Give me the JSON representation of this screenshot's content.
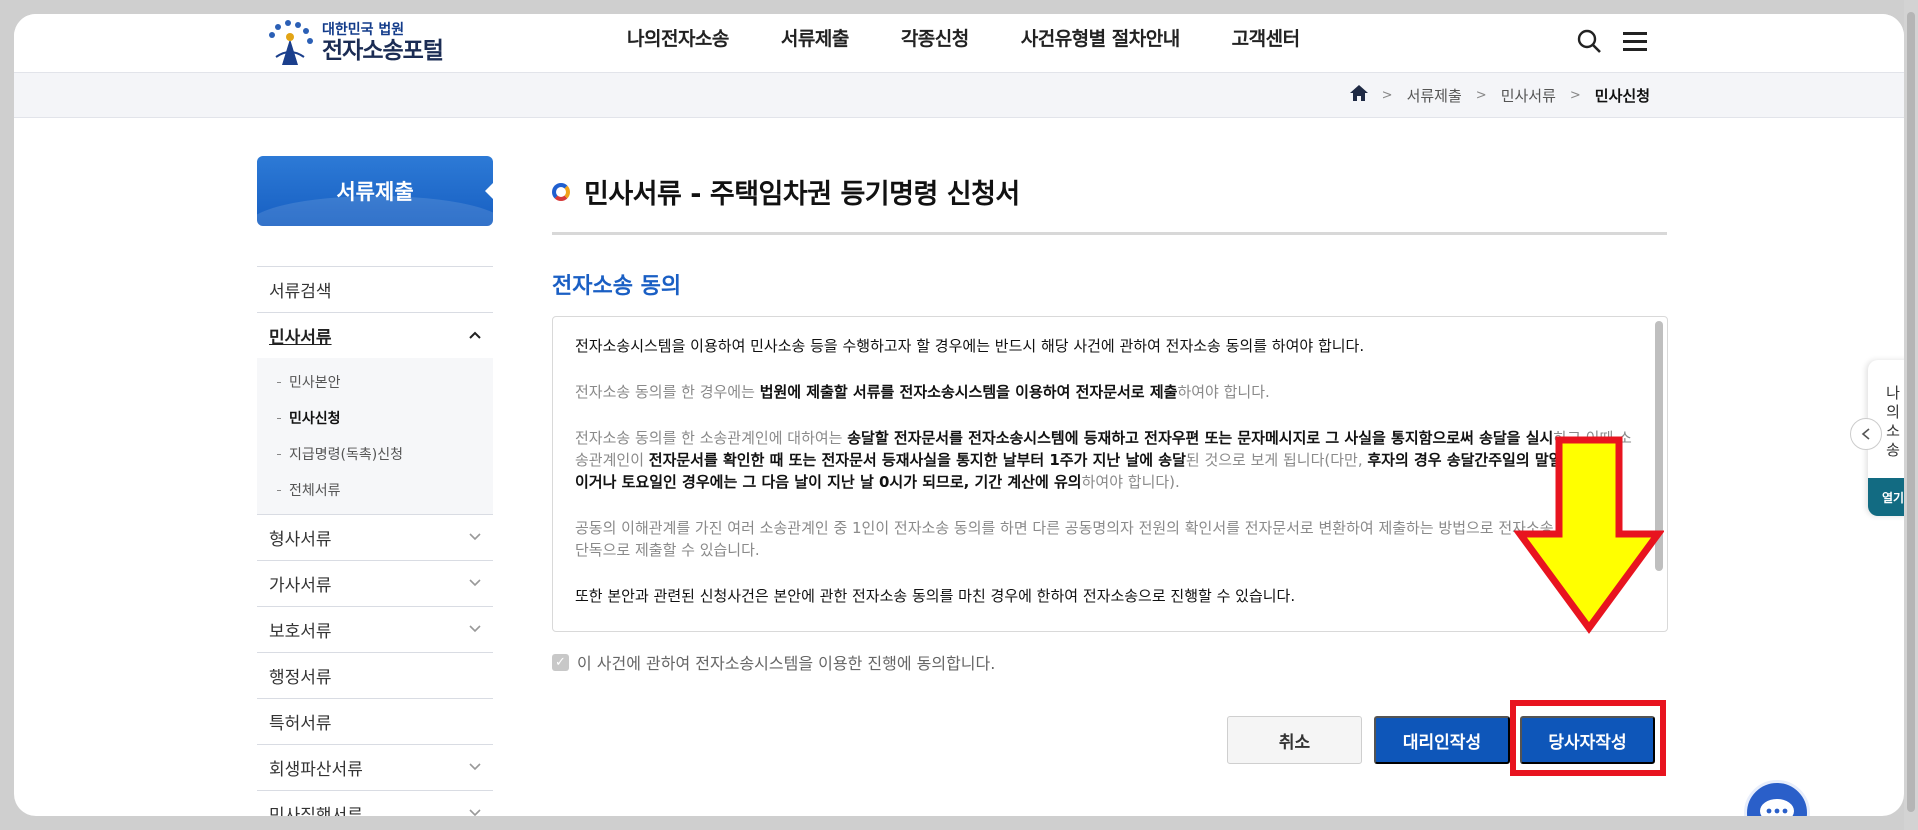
{
  "header": {
    "logo_small": "대한민국 법원",
    "logo_big": "전자소송포털",
    "nav": [
      "나의전자소송",
      "서류제출",
      "각종신청",
      "사건유형별 절차안내",
      "고객센터"
    ]
  },
  "breadcrumb": {
    "items": [
      "서류제출",
      "민사서류",
      "민사신청"
    ]
  },
  "sidebar": {
    "title": "서류제출",
    "items": [
      {
        "label": "서류검색"
      },
      {
        "label": "민사서류"
      },
      {
        "label": "형사서류"
      },
      {
        "label": "가사서류"
      },
      {
        "label": "보호서류"
      },
      {
        "label": "행정서류"
      },
      {
        "label": "특허서류"
      },
      {
        "label": "회생파산서류"
      },
      {
        "label": "민사집행서류"
      }
    ],
    "sub_items": [
      "민사본안",
      "민사신청",
      "지급명령(독촉)신청",
      "전체서류"
    ]
  },
  "content": {
    "page_title": "민사서류 - 주택임차권 등기명령 신청서",
    "section_title": "전자소송 동의",
    "notice": {
      "p1": "전자소송시스템을 이용하여 민사소송 등을 수행하고자 할 경우에는 반드시 해당 사건에 관하여 전자소송 동의를 하여야 합니다.",
      "p2_a": "전자소송 동의를 한 경우에는 ",
      "p2_b": "법원에 제출할 서류를 전자소송시스템을 이용하여 전자문서로 제출",
      "p2_c": "하여야 합니다.",
      "p3_a": "전자소송 동의를 한 소송관계인에 대하여는 ",
      "p3_b": "송달할 전자문서를 전자소송시스템에 등재하고 전자우편 또는 문자메시지로 그 사실을 통지함으로써 송달을 실시",
      "p3_c": "하고 이때 소송관계인이 ",
      "p3_d": "전자문서를 확인한 때 또는 전자문서 등재사실을 통지한 날부터 1주가 지난 날에 송달",
      "p3_e": "된 것으로 보게 됩니다(다만, ",
      "p3_f": "후자의 경우 송달간주일의 말일이 공휴일이거나 토요일인 경우에는 그 다음 날이 지난 날 0시가 되므로, 기간 계산에 유의",
      "p3_g": "하여야 합니다).",
      "p4": "공동의 이해관계를 가진 여러 소송관계인 중 1인이 전자소송 동의를 하면 다른 공동명의자 전원의 확인서를 전자문서로 변환하여 제출하는 방법으로 전자소송 동의 없이 단독으로 제출할 수 있습니다.",
      "p5": "또한 본안과 관련된 신청사건은 본안에 관한 전자소송 동의를 마친 경우에 한하여 전자소송으로 진행할 수 있습니다."
    },
    "agree_label": "이 사건에 관하여 전자소송시스템을 이용한 진행에 동의합니다.",
    "agree_checked": true,
    "buttons": {
      "cancel": "취소",
      "proxy": "대리인작성",
      "self": "당사자작성"
    }
  },
  "float_panel": {
    "vertical_text": "나의소송",
    "open_label": "열기"
  },
  "colors": {
    "primary": "#0e56b9",
    "highlight": "#e8141f",
    "arrow_fill": "#ffff00",
    "arrow_stroke": "#e8141f",
    "teal": "#126b82"
  }
}
